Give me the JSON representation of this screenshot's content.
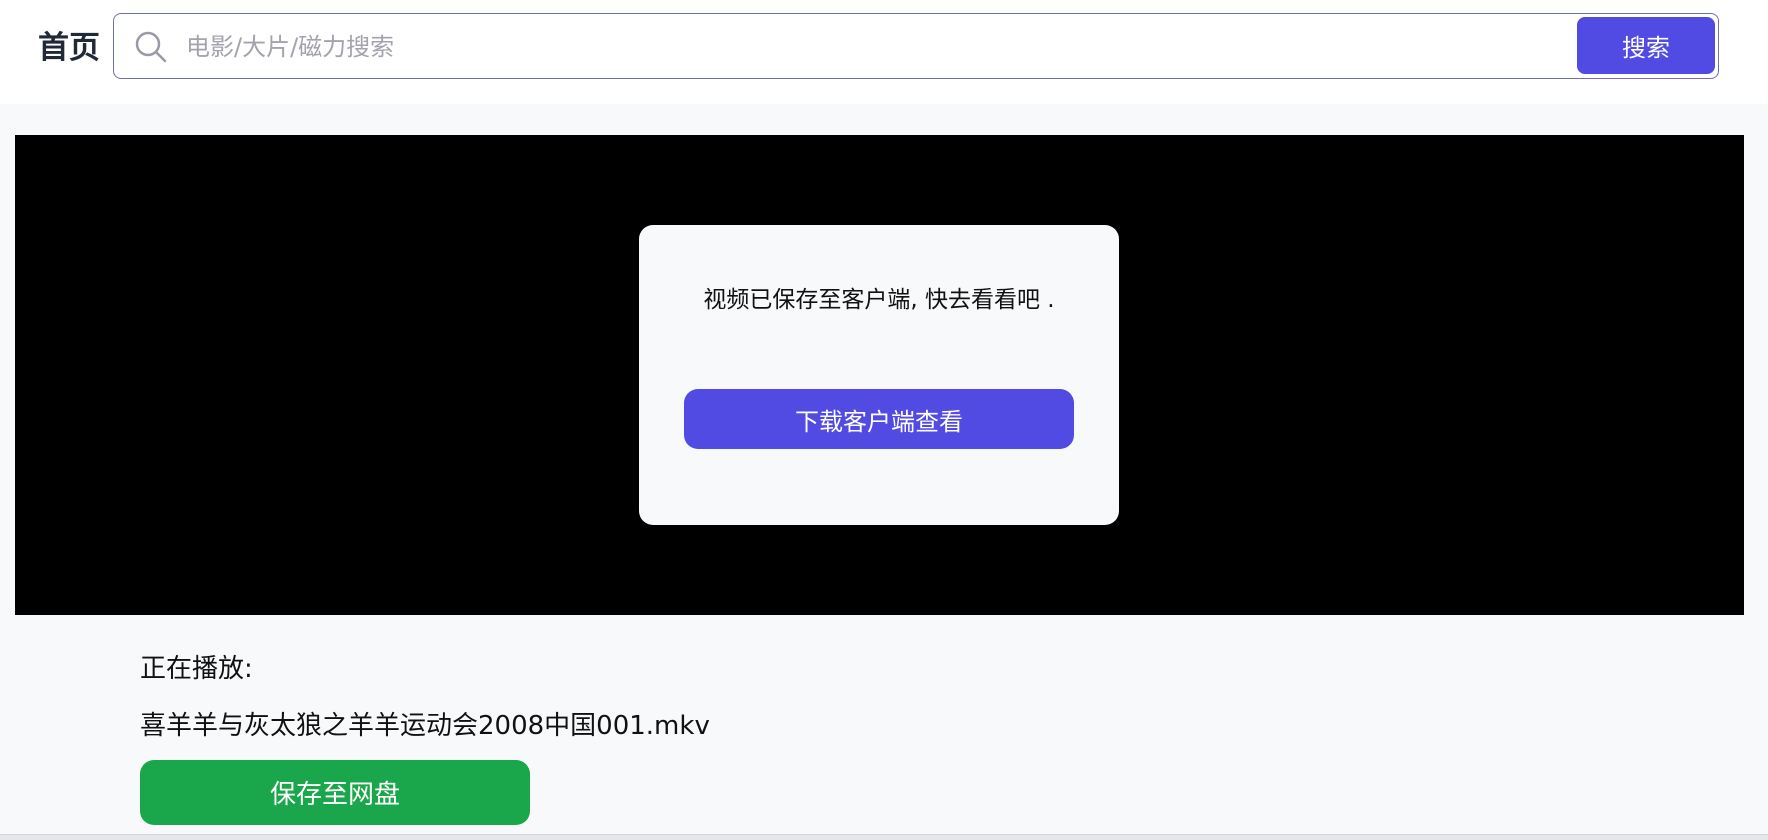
{
  "header": {
    "home_label": "首页",
    "search": {
      "placeholder": "电影/大片/磁力搜索",
      "value": "",
      "button_label": "搜索",
      "icon": "search-icon"
    }
  },
  "player": {
    "modal": {
      "message": "视频已保存至客户端, 快去看看吧 .",
      "button_label": "下载客户端查看"
    }
  },
  "now_playing": {
    "label": "正在播放:",
    "file_name": "喜羊羊与灰太狼之羊羊运动会2008中国001.mkv",
    "save_button_label": "保存至网盘"
  },
  "colors": {
    "accent": "#514ae3",
    "save": "#1aa64a",
    "player_bg": "#000000",
    "page_bg": "#f8f9fb"
  }
}
